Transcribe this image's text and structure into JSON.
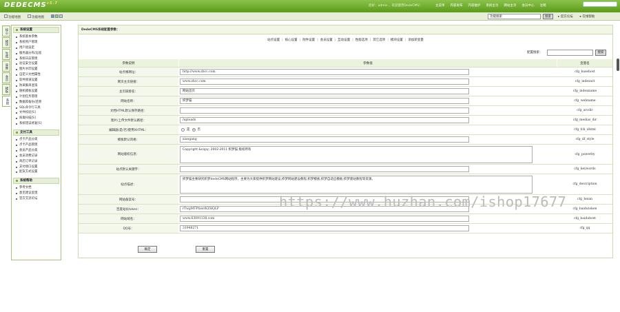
{
  "top": {
    "logo": "DEDECMS",
    "logo_ver": "v5.7",
    "welcome": "您好：admin ，欢迎使用DedeCMS！",
    "nav": [
      "主菜单",
      "内容发布",
      "内容维护",
      "系统主页",
      "网站主页",
      "会员中心",
      "注销"
    ]
  },
  "sub": {
    "left": [
      "功能地图",
      "功能地图"
    ],
    "search_value": "功能搜索",
    "search_btn": "搜索",
    "links": [
      "官方论坛",
      "在线帮助"
    ]
  },
  "left_tabs": [
    "核心",
    "模块",
    "生成",
    "采集",
    "会员",
    "模板",
    "系统"
  ],
  "menu": {
    "g1": "系统设置",
    "g1_items": [
      "系统基本参数",
      "系统用户管理",
      "用户组设定",
      "服务器分布/远程",
      "系统日志管理",
      "验证安全设置",
      "图片水印设置",
      "自定义文档属性",
      "软件频道设置",
      "防采集串混淆",
      "随机模板设置",
      "计划任务管理",
      "数据库备份/还原",
      "SQL命令行工具",
      "文件校验[S]",
      "病毒扫描[S]",
      "系统错误修复[S]"
    ],
    "g2": "支付工具",
    "g2_items": [
      "点卡产品分类",
      "点卡产品管理",
      "会员产品分类",
      "会员消费记录",
      "商店订单记录",
      "支付接口设置",
      "配货方式设置"
    ],
    "g3": "系统帮助",
    "g3_items": [
      "参考文档",
      "意见建议反馈",
      "官方交流论坛"
    ]
  },
  "main": {
    "title": "DedeCMS系统配置参数：",
    "tabs": [
      "站点设置",
      "核心设置",
      "附件设置",
      "会员设置",
      "互动设置",
      "性能选项",
      "其它选项",
      "模块设置",
      "添加新变量"
    ],
    "search_label": "配置搜索：",
    "search_btn": "搜索",
    "col1": "参数说明",
    "col2": "参数值",
    "col3": "变量名",
    "rows": [
      {
        "label": "站点根网址：",
        "value": "http://www.zhcc.com",
        "var": "cfg_basehost"
      },
      {
        "label": "网页主页链接：",
        "value": "www.zhcc.com",
        "var": "cfg_indexurl"
      },
      {
        "label": "主页链接名：",
        "value": "网站首页",
        "var": "cfg_indexname"
      },
      {
        "label": "网站名称：",
        "value": "织梦猫",
        "var": "cfg_webname"
      },
      {
        "label": "文档HTML默认保存路径：",
        "value": "",
        "var": "cfg_arcdir"
      },
      {
        "label": "图片/上传文件默认路径：",
        "value": "/uploads",
        "var": "cfg_medias_dir"
      },
      {
        "label": "编辑器(是/否)使用XHTML：",
        "value": "",
        "var": "cfg_fck_xhtml"
      },
      {
        "label": "模板默认风格：",
        "value": "xiaogang",
        "var": "cfg_df_style"
      },
      {
        "label": "网站版权信息：",
        "value": "Copyright &copy; 2002-2011 织梦猫 版权所有",
        "var": "cfg_powerby"
      },
      {
        "label": "站点默认关键字：",
        "value": "",
        "var": "cfg_keywords"
      },
      {
        "label": "站点描述：",
        "value": "织梦猫主要研究织梦dedeCMS网站程序，主要为大家提供织梦网站建设,织梦网站建设教程,织梦模板,织梦自适应模板,织梦建站教程等资源。",
        "var": "cfg_description"
      },
      {
        "label": "网站备案号：",
        "value": "",
        "var": "cfg_beian"
      },
      {
        "label": "百度站长token：",
        "value": "rTwgMTPfawrKZHQLP",
        "var": "cfg_baidutoken"
      },
      {
        "label": "网站域名：",
        "value": "www.63091138.com",
        "var": "cfg_baiduhost"
      },
      {
        "label": "QQ号：",
        "value": "31948271",
        "var": "cfg_qq"
      }
    ],
    "radio_yes": "是",
    "radio_no": "否",
    "ok": "确定",
    "reset": "重置"
  },
  "watermark": "https://www.huzhan.com/ishop17677"
}
